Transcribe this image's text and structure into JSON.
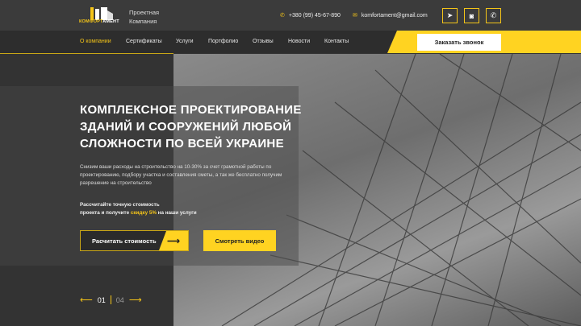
{
  "header": {
    "logo": "КОМФОРТАМЕНТ",
    "logo_a": "КОМФОРТ",
    "logo_b": "АМЕНТ",
    "company_line1": "Проектная",
    "company_line2": "Компания",
    "phone": "+380 (99) 45-67-890",
    "email": "komfortament@gmail.com",
    "socials": [
      "telegram-icon",
      "instagram-icon",
      "whatsapp-icon"
    ]
  },
  "nav": {
    "items": [
      "О компании",
      "Сертификаты",
      "Услуги",
      "Портфолио",
      "Отзывы",
      "Новости",
      "Контакты"
    ],
    "active": 0,
    "call_button": "Заказать звонок"
  },
  "hero": {
    "title": "КОМПЛЕКСНОЕ ПРОЕКТИРОВАНИЕ ЗДАНИЙ И СООРУЖЕНИЙ ЛЮБОЙ СЛОЖНОСТИ ПО ВСЕЙ УКРАИНЕ",
    "description": "Снизим ваши расходы на строительство на 10-30% за счет грамотной работы по проектированию, подбору участка и составления сметы, а так же бесплатно получим разрешение на строительство",
    "offer_1": "Рассчитайте точную стоимость",
    "offer_2": "проекта и получите ",
    "offer_highlight": "скидку 5%",
    "offer_3": " на наши услуги",
    "calc_button": "Расчитать стоимость",
    "video_button": "Смотреть видео"
  },
  "slider": {
    "current": "01",
    "total": "04"
  },
  "colors": {
    "accent": "#ffd321",
    "dark": "#2d2d2d"
  }
}
